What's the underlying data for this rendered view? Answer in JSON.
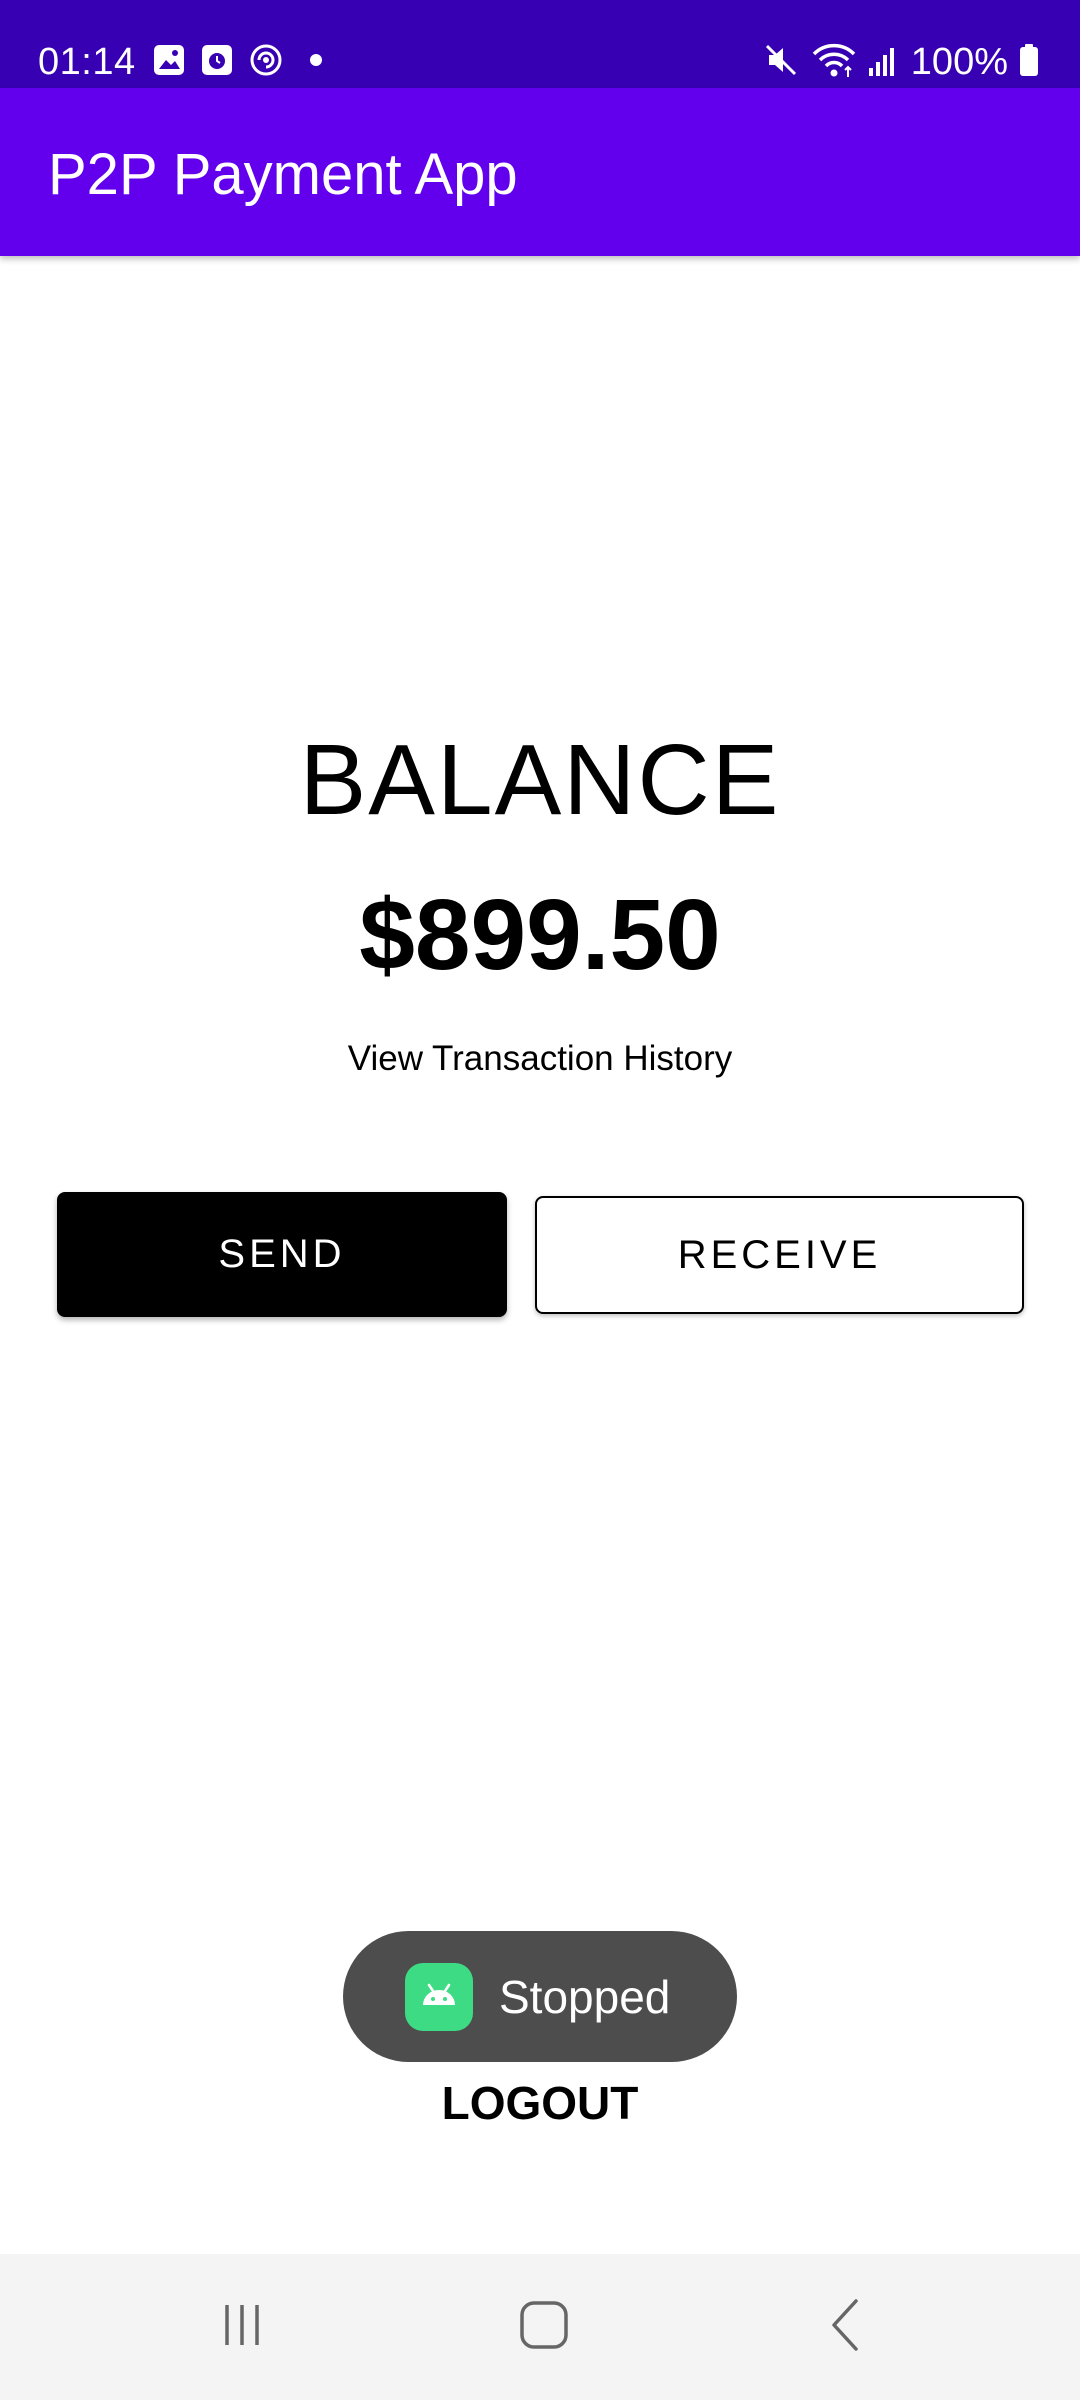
{
  "status_bar": {
    "time": "01:14",
    "battery": "100%",
    "left_icons": [
      "gallery-icon",
      "calendar-icon",
      "sync-icon",
      "notification-dot-icon"
    ],
    "right_icons": [
      "mute-icon",
      "wifi-icon",
      "signal-icon",
      "battery-icon"
    ]
  },
  "app_bar": {
    "title": "P2P Payment App"
  },
  "main": {
    "balance_label": "BALANCE",
    "balance_amount": "$899.50",
    "history_link": "View Transaction History",
    "send_label": "SEND",
    "receive_label": "RECEIVE",
    "logout_label": "LOGOUT"
  },
  "toast": {
    "text": "Stopped",
    "icon": "android-icon"
  },
  "nav_bar": {
    "buttons": [
      "recents-icon",
      "home-icon",
      "back-icon"
    ]
  },
  "colors": {
    "status_bar": "#3700b3",
    "app_bar": "#6200ee",
    "send_button": "#000000",
    "toast_background": "#4d4d4d",
    "android_green": "#3ddc84",
    "nav_bar": "#f4f4f4"
  }
}
